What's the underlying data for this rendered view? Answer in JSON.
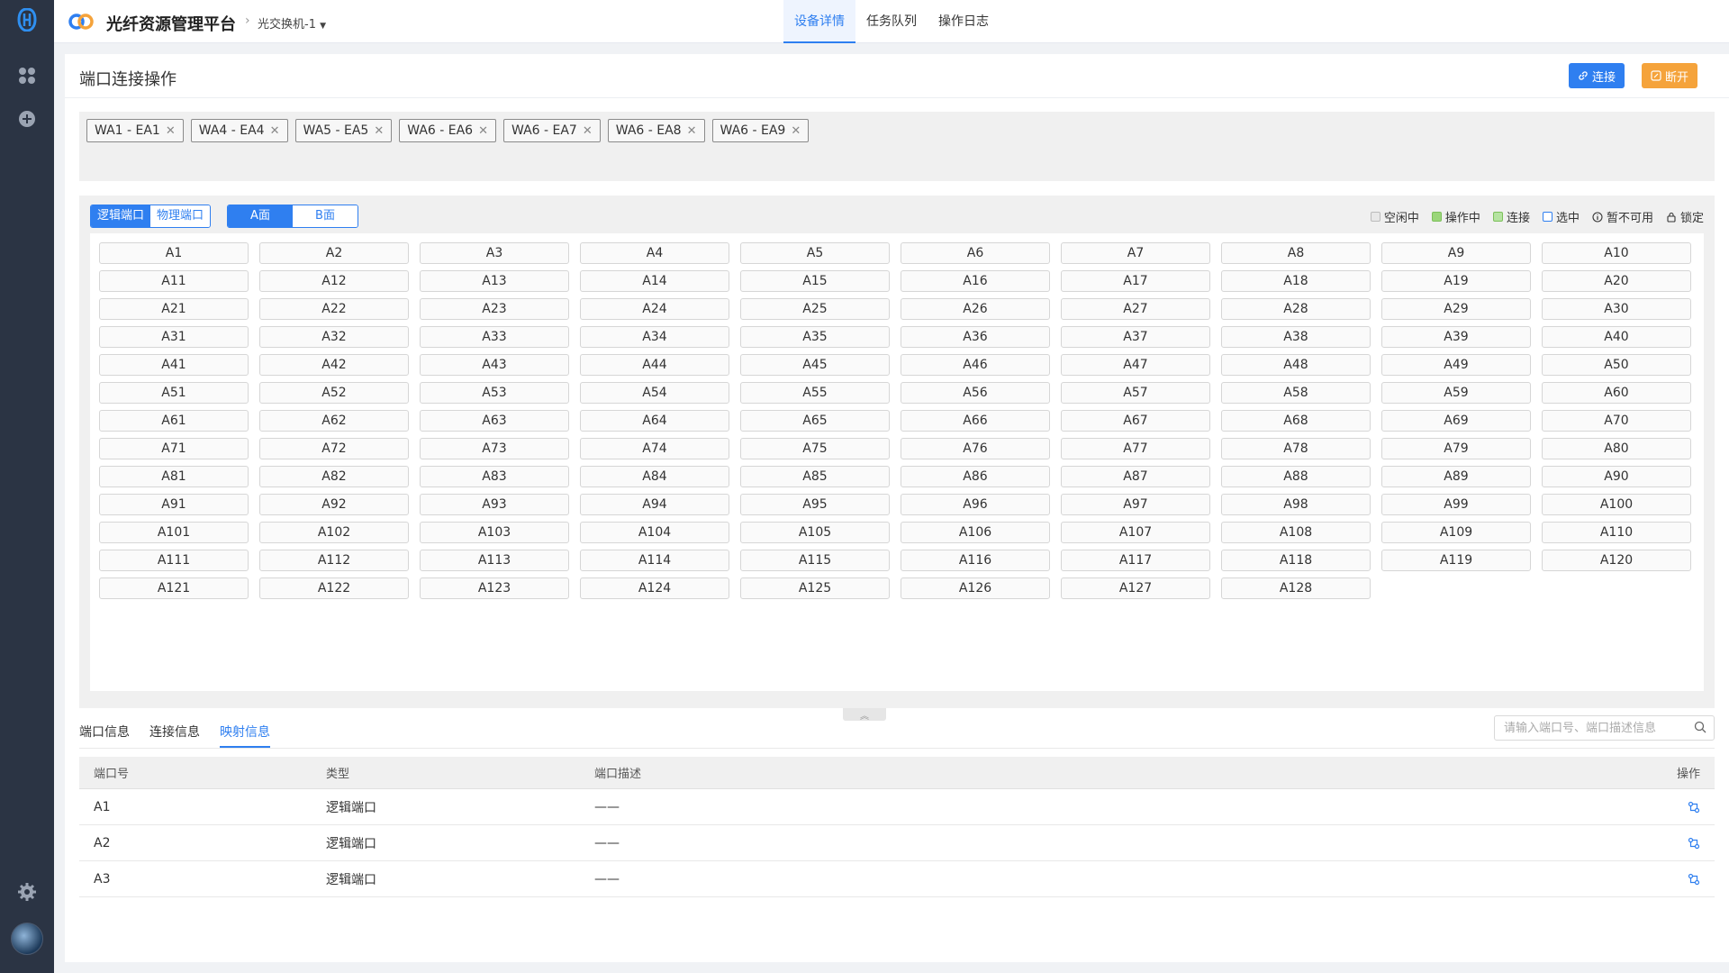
{
  "header": {
    "app_title": "光纤资源管理平台",
    "breadcrumb_device": "光交换机-1",
    "tabs": [
      {
        "label": "设备详情",
        "active": true
      },
      {
        "label": "任务队列",
        "active": false
      },
      {
        "label": "操作日志",
        "active": false
      }
    ]
  },
  "page": {
    "title": "端口连接操作",
    "connect_label": "连接",
    "disconnect_label": "断开"
  },
  "connections": [
    "WA1 - EA1",
    "WA4 - EA4",
    "WA5 - EA5",
    "WA6 - EA6",
    "WA6 - EA7",
    "WA6 - EA8",
    "WA6 - EA9"
  ],
  "port_type_toggle": {
    "options": [
      "逻辑端口",
      "物理端口"
    ],
    "selected": "逻辑端口"
  },
  "face_toggle": {
    "options": [
      "A面",
      "B面"
    ],
    "selected": "A面"
  },
  "legend": [
    {
      "label": "空闲中",
      "color": "#e8e8e8",
      "icon": "square"
    },
    {
      "label": "操作中",
      "color": "#9bd67a",
      "icon": "square"
    },
    {
      "label": "连接",
      "color": "#b5e3a1",
      "icon": "square"
    },
    {
      "label": "选中",
      "color": "#ffffff",
      "icon": "square-outline-blue"
    },
    {
      "label": "暂不可用",
      "color": "#333333",
      "icon": "info-circle-icon"
    },
    {
      "label": "锁定",
      "color": "#333333",
      "icon": "lock-icon"
    }
  ],
  "ports": [
    "A1",
    "A2",
    "A3",
    "A4",
    "A5",
    "A6",
    "A7",
    "A8",
    "A9",
    "A10",
    "A11",
    "A12",
    "A13",
    "A14",
    "A15",
    "A16",
    "A17",
    "A18",
    "A19",
    "A20",
    "A21",
    "A22",
    "A23",
    "A24",
    "A25",
    "A26",
    "A27",
    "A28",
    "A29",
    "A30",
    "A31",
    "A32",
    "A33",
    "A34",
    "A35",
    "A36",
    "A37",
    "A38",
    "A39",
    "A40",
    "A41",
    "A42",
    "A43",
    "A44",
    "A45",
    "A46",
    "A47",
    "A48",
    "A49",
    "A50",
    "A51",
    "A52",
    "A53",
    "A54",
    "A55",
    "A56",
    "A57",
    "A58",
    "A59",
    "A60",
    "A61",
    "A62",
    "A63",
    "A64",
    "A65",
    "A66",
    "A67",
    "A68",
    "A69",
    "A70",
    "A71",
    "A72",
    "A73",
    "A74",
    "A75",
    "A76",
    "A77",
    "A78",
    "A79",
    "A80",
    "A81",
    "A82",
    "A83",
    "A84",
    "A85",
    "A86",
    "A87",
    "A88",
    "A89",
    "A90",
    "A91",
    "A92",
    "A93",
    "A94",
    "A95",
    "A96",
    "A97",
    "A98",
    "A99",
    "A100",
    "A101",
    "A102",
    "A103",
    "A104",
    "A105",
    "A106",
    "A107",
    "A108",
    "A109",
    "A110",
    "A111",
    "A112",
    "A113",
    "A114",
    "A115",
    "A116",
    "A117",
    "A118",
    "A119",
    "A120",
    "A121",
    "A122",
    "A123",
    "A124",
    "A125",
    "A126",
    "A127",
    "A128"
  ],
  "info_tabs": [
    {
      "label": "端口信息",
      "active": false
    },
    {
      "label": "连接信息",
      "active": false
    },
    {
      "label": "映射信息",
      "active": true
    }
  ],
  "search": {
    "placeholder": "请输入端口号、端口描述信息"
  },
  "table": {
    "columns": [
      "端口号",
      "类型",
      "端口描述",
      "操作"
    ],
    "rows": [
      {
        "port": "A1",
        "type": "逻辑端口",
        "desc": "——"
      },
      {
        "port": "A2",
        "type": "逻辑端口",
        "desc": "——"
      },
      {
        "port": "A3",
        "type": "逻辑端口",
        "desc": "——"
      }
    ]
  },
  "colors": {
    "accent": "#2f7ff0",
    "warning": "#f5a33b",
    "rail": "#2b3444"
  }
}
